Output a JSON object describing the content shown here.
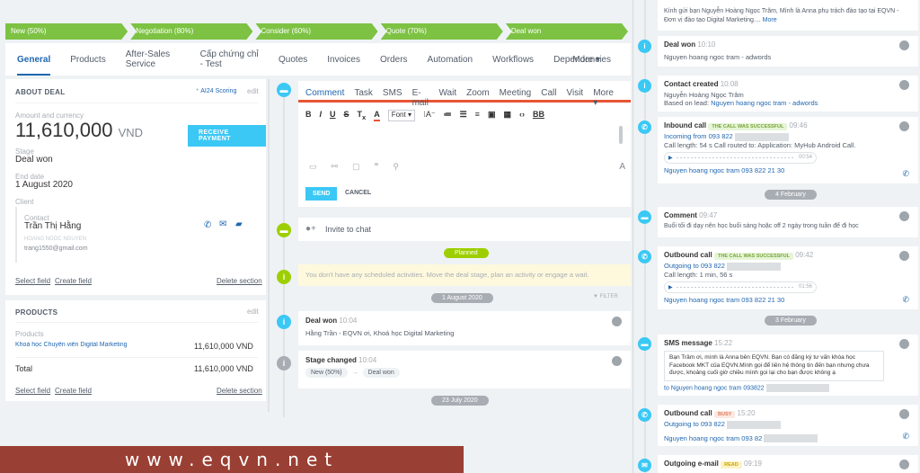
{
  "stages": [
    "New (50%)",
    "Negotiation (80%)",
    "Consider (60%)",
    "Quote (70%)",
    "Deal won"
  ],
  "tabs": [
    "General",
    "Products",
    "After-Sales Service",
    "Cấp chứng chỉ - Test",
    "Quotes",
    "Invoices",
    "Orders",
    "Automation",
    "Workflows",
    "Dependencies",
    "More"
  ],
  "about": {
    "title": "ABOUT DEAL",
    "ai": "AI24 Scoring",
    "edit": "edit",
    "amount_label": "Amount and currency",
    "amount": "11,610,000",
    "currency": "VND",
    "pay_btn": "RECEIVE PAYMENT",
    "stage_label": "Stage",
    "stage": "Deal won",
    "end_label": "End date",
    "end": "1 August 2020",
    "client_label": "Client",
    "contact_label": "Contact",
    "contact": "Trần Thị Hằng",
    "contact_sub": "HOANG NGOC NGUYEN",
    "contact_email": "trang1550@gmail.com",
    "select_field": "Select field",
    "create_field": "Create field",
    "delete_section": "Delete section"
  },
  "products": {
    "title": "PRODUCTS",
    "edit": "edit",
    "label": "Products",
    "item": "Khoá học Chuyên viên Digital Marketing",
    "item_price": "11,610,000 VND",
    "total_label": "Total",
    "total": "11,610,000 VND",
    "select_field": "Select field",
    "create_field": "Create field",
    "delete_section": "Delete section"
  },
  "comment_tabs": [
    "Comment",
    "Task",
    "SMS",
    "E-mail",
    "Wait",
    "Zoom",
    "Meeting",
    "Call",
    "Visit",
    "More"
  ],
  "editor": {
    "font": "Font",
    "send": "SEND",
    "cancel": "CANCEL"
  },
  "chat": "Invite to chat",
  "planned": "Planned",
  "no_activity": "You don't have any scheduled activities. Move the deal stage, plan an activity or engage a wait.",
  "date1": "1 August 2020",
  "filter": "FILTER",
  "feed1": {
    "title": "Deal won",
    "time": "10:04",
    "text": "Hằng Trần - EQVN ơi, Khoá học Digital Marketing"
  },
  "feed2": {
    "title": "Stage changed",
    "time": "10:04",
    "from": "New (50%)",
    "arrow": "→",
    "to": "Deal won"
  },
  "date2": "23 July 2020",
  "right": {
    "top_text": "Kính gửi bạn Nguyễn Hoàng Ngọc Trâm, Mình là Anna phụ trách đào tạo tại EQVN - Đơn vị đào tạo Digital Marketing....",
    "top_more": "More",
    "r1": {
      "title": "Deal won",
      "time": "10:10",
      "text": "Nguyen hoang ngoc tram - adwords"
    },
    "r2": {
      "title": "Contact created",
      "time": "10:08",
      "text": "Nguyễn Hoàng Ngọc Trâm",
      "based": "Based on lead:",
      "lead": "Nguyen hoang ngoc tram - adwords"
    },
    "r3": {
      "title": "Inbound call",
      "badge": "THE CALL WAS SUCCESSFUL",
      "time": "09:46",
      "from": "Incoming from 093 822",
      "len": "Call length: 54 s Call routed to: Application: MyHub Android Call.",
      "audio": "00:54",
      "contact": "Nguyen hoang ngoc tram 093 822 21 30"
    },
    "date_feb4": "4 February",
    "r4": {
      "title": "Comment",
      "time": "09:47",
      "text": "Buổi tối đi dạy nên học buổi sáng hoặc off 2 ngày trong tuần để đi học"
    },
    "r5": {
      "title": "Outbound call",
      "badge": "THE CALL WAS SUCCESSFUL",
      "time": "09:42",
      "to": "Outgoing to 093 822",
      "len": "Call length: 1 min, 56 s",
      "audio": "01:56",
      "contact": "Nguyen hoang ngoc tram 093 822 21 30"
    },
    "date_feb3": "3 February",
    "r6": {
      "title": "SMS message",
      "time": "15:22",
      "text": "Bạn Trâm ơi, mình là Anna bên EQVN. Bạn có đăng ký tư vấn khóa học Facebook MKT của EQVN.Mình gọi để liên hệ thông tin đến bạn nhưng chưa được, khoảng cuối giờ chiều mình gọi lại cho bạn được không ạ",
      "to": "to Nguyen hoang ngoc tram 093822"
    },
    "r7": {
      "title": "Outbound call",
      "badge": "BUSY",
      "time": "15:20",
      "to": "Outgoing to 093 822",
      "contact": "Nguyen hoang ngoc tram 093 82"
    },
    "r8": {
      "title": "Outgoing e-mail",
      "badge": "READ",
      "time": "09:19"
    }
  },
  "watermark": "www.eqvn.net"
}
